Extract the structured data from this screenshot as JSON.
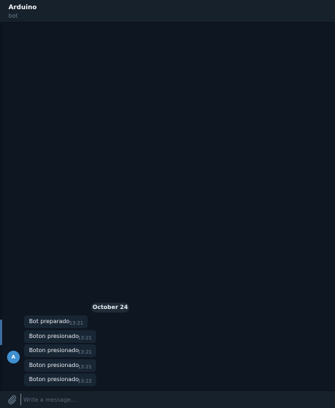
{
  "header": {
    "title": "Arduino",
    "status": "bot"
  },
  "chat": {
    "date_separator": "October 24",
    "avatar_initial": "A",
    "messages": [
      {
        "text": "Bot preparado",
        "time": "13:21"
      },
      {
        "text": "Boton presionado",
        "time": "13:21"
      },
      {
        "text": "Boton presionado",
        "time": "13:21"
      },
      {
        "text": "Boton presionado",
        "time": "13:21"
      },
      {
        "text": "Boton presionado",
        "time": "13:22"
      }
    ]
  },
  "composer": {
    "placeholder": "Write a message...",
    "attach_icon": "paperclip-icon"
  },
  "colors": {
    "background": "#0e1621",
    "panel": "#17212b",
    "bubble": "#182533",
    "accent": "#3f8fd0",
    "muted_text": "#6d7f8f"
  }
}
